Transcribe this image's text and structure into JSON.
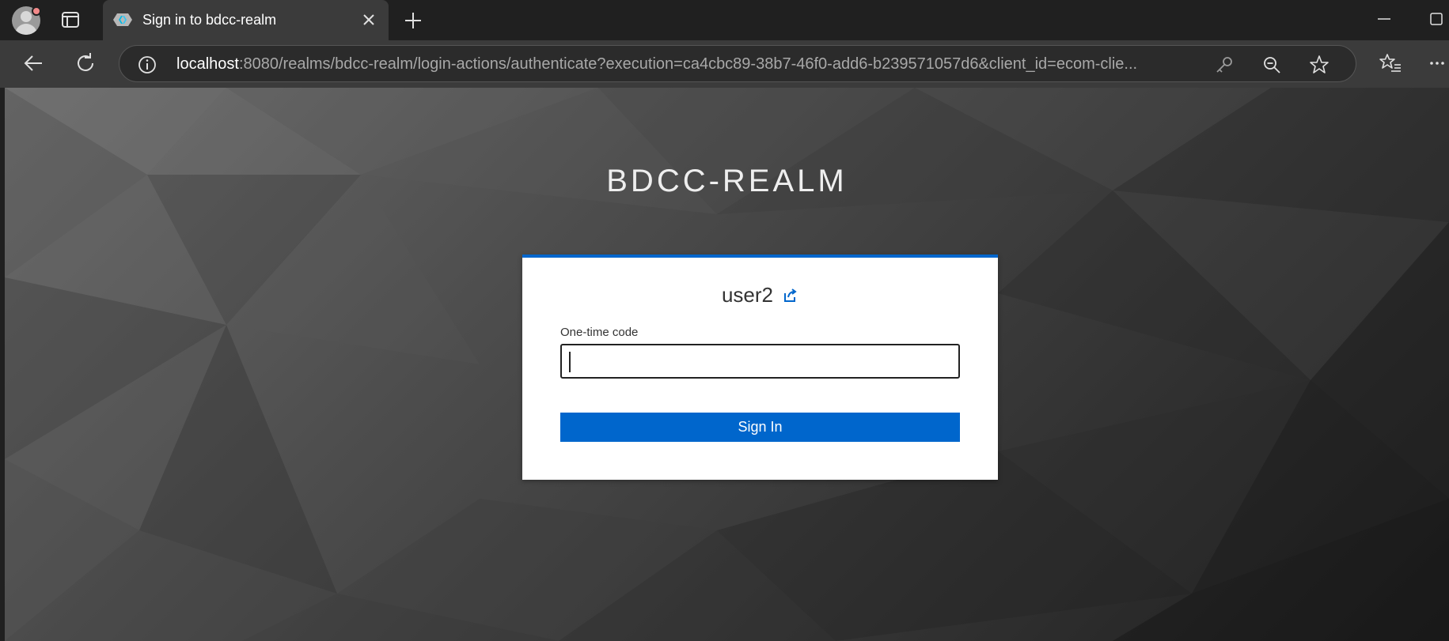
{
  "browser": {
    "tab": {
      "title": "Sign in to bdcc-realm",
      "favicon": "keycloak-favicon"
    },
    "address_bar": {
      "host": "localhost",
      "path": ":8080/realms/bdcc-realm/login-actions/authenticate?execution=ca4cbc89-38b7-46f0-add6-b239571057d6&client_id=ecom-clie..."
    },
    "icons": {
      "profile": "profile-icon",
      "tabs": "tab-actions-icon",
      "close": "close-icon",
      "new_tab": "plus-icon",
      "minimize": "minimize-icon",
      "maximize": "maximize-icon",
      "back": "back-arrow-icon",
      "refresh": "refresh-icon",
      "info": "info-icon",
      "key": "key-icon",
      "zoom": "zoom-out-icon",
      "favorite": "star-icon",
      "favorites": "favorites-icon",
      "more": "more-icon"
    }
  },
  "login": {
    "realm_title": "BDCC-REALM",
    "username": "user2",
    "otp_label": "One-time code",
    "otp_value": "",
    "sign_in_label": "Sign In"
  },
  "colors": {
    "accent": "#0066cc",
    "card_bg": "#ffffff",
    "chrome_bg": "#202020",
    "toolbar_bg": "#3b3b3b"
  }
}
